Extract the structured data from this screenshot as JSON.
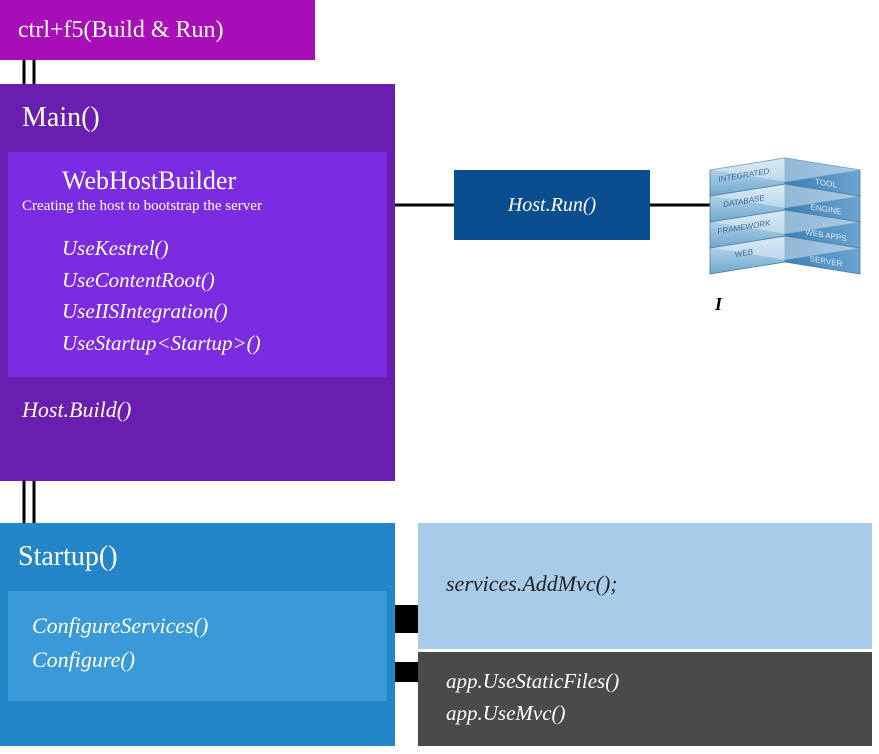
{
  "ctrl_f5": "ctrl+f5(Build & Run)",
  "main": {
    "title": "Main()",
    "webhost": {
      "title": "WebHostBuilder",
      "subtitle": "Creating the host to bootstrap the server",
      "methods": [
        "UseKestrel()",
        "UseContentRoot()",
        "UseIISIntegration()",
        "UseStartup<Startup>()"
      ]
    },
    "host_build": "Host.Build()"
  },
  "host_run": "Host.Run()",
  "startup": {
    "title": "Startup()",
    "methods": [
      "ConfigureServices()",
      "Configure()"
    ]
  },
  "addmvc": "services.AddMvc();",
  "usestatic": [
    "app.UseStaticFiles()",
    "app.UseMvc()"
  ],
  "iis_label": "I",
  "server_layers": [
    [
      "INTEGRATED",
      "TOOL"
    ],
    [
      "DATABASE",
      "ENGINE"
    ],
    [
      "FRAMEWORK",
      "WEB APPS"
    ],
    [
      "WEB",
      "SERVER"
    ]
  ],
  "colors": {
    "magenta": "#a80eb8",
    "purple_dark": "#6a1eb0",
    "purple_light": "#7b2ce0",
    "blue_dark": "#0a4e8f",
    "blue_mid": "#2486c9",
    "blue_light": "#3a9ad8",
    "blue_pale": "#a7cbe8",
    "gray_dark": "#4a4a4a"
  }
}
